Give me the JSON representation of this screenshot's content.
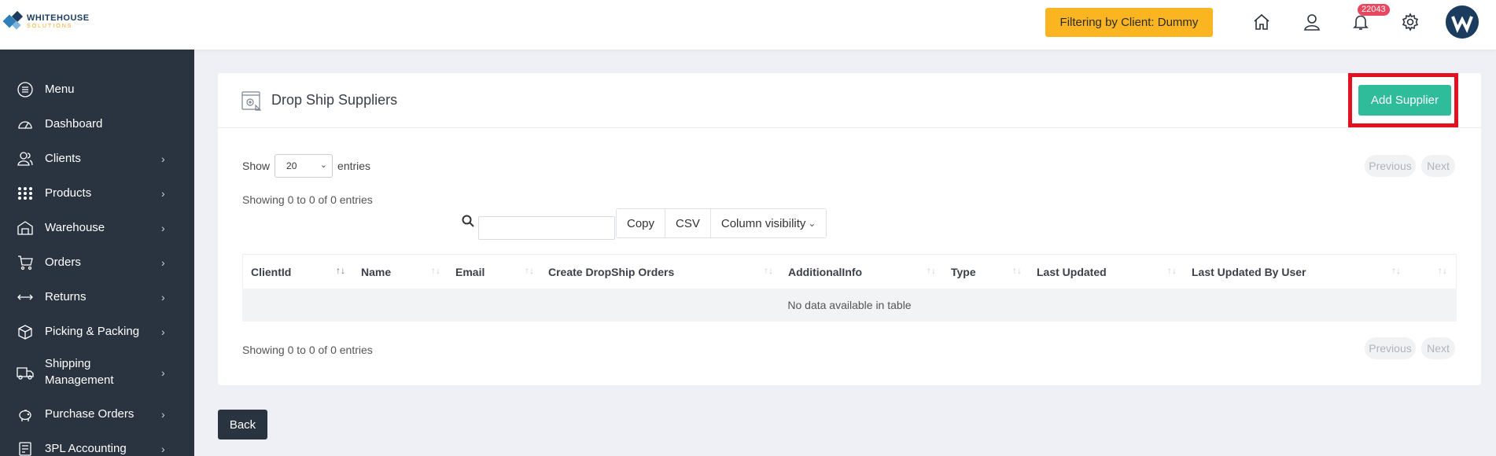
{
  "header": {
    "logo_line1": "WHITEHOUSE",
    "logo_line2": "SOLUTIONS",
    "filter_badge": "Filtering by Client: Dummy",
    "notification_count": "22043",
    "icons": [
      "home-icon",
      "user-icon",
      "bell-icon",
      "gear-icon",
      "avatar"
    ]
  },
  "sidebar": {
    "items": [
      {
        "label": "Menu",
        "icon": "menu-icon",
        "chevron": false
      },
      {
        "label": "Dashboard",
        "icon": "dashboard-icon",
        "chevron": false
      },
      {
        "label": "Clients",
        "icon": "clients-icon",
        "chevron": true
      },
      {
        "label": "Products",
        "icon": "grid-icon",
        "chevron": true
      },
      {
        "label": "Warehouse",
        "icon": "warehouse-icon",
        "chevron": true
      },
      {
        "label": "Orders",
        "icon": "cart-icon",
        "chevron": true
      },
      {
        "label": "Returns",
        "icon": "returns-icon",
        "chevron": true
      },
      {
        "label": "Picking & Packing",
        "icon": "box-icon",
        "chevron": true
      },
      {
        "label": "Shipping",
        "label2": "Management",
        "icon": "truck-icon",
        "chevron": true
      },
      {
        "label": "Purchase Orders",
        "icon": "piggy-bank-icon",
        "chevron": true
      },
      {
        "label": "3PL Accounting",
        "icon": "accounting-icon",
        "chevron": true
      }
    ]
  },
  "card": {
    "title": "Drop Ship Suppliers",
    "add_button": "Add Supplier",
    "show_label": "Show",
    "entries_label": "entries",
    "page_size": "20",
    "info_top": "Showing 0 to 0 of 0 entries",
    "info_bottom": "Showing 0 to 0 of 0 entries",
    "previous": "Previous",
    "next": "Next",
    "buttons": {
      "copy": "Copy",
      "csv": "CSV",
      "column_visibility": "Column visibility"
    },
    "columns": [
      "ClientId",
      "Name",
      "Email",
      "Create DropShip Orders",
      "AdditionalInfo",
      "Type",
      "Last Updated",
      "Last Updated By User",
      ""
    ],
    "empty_message": "No data available in table"
  },
  "footer": {
    "back_button": "Back"
  },
  "colors": {
    "sidebar_bg": "#2a3340",
    "accent_green": "#2fbc9a",
    "filter_yellow": "#fbb521",
    "highlight_red": "#e3101f",
    "badge_red": "#e8475f"
  }
}
